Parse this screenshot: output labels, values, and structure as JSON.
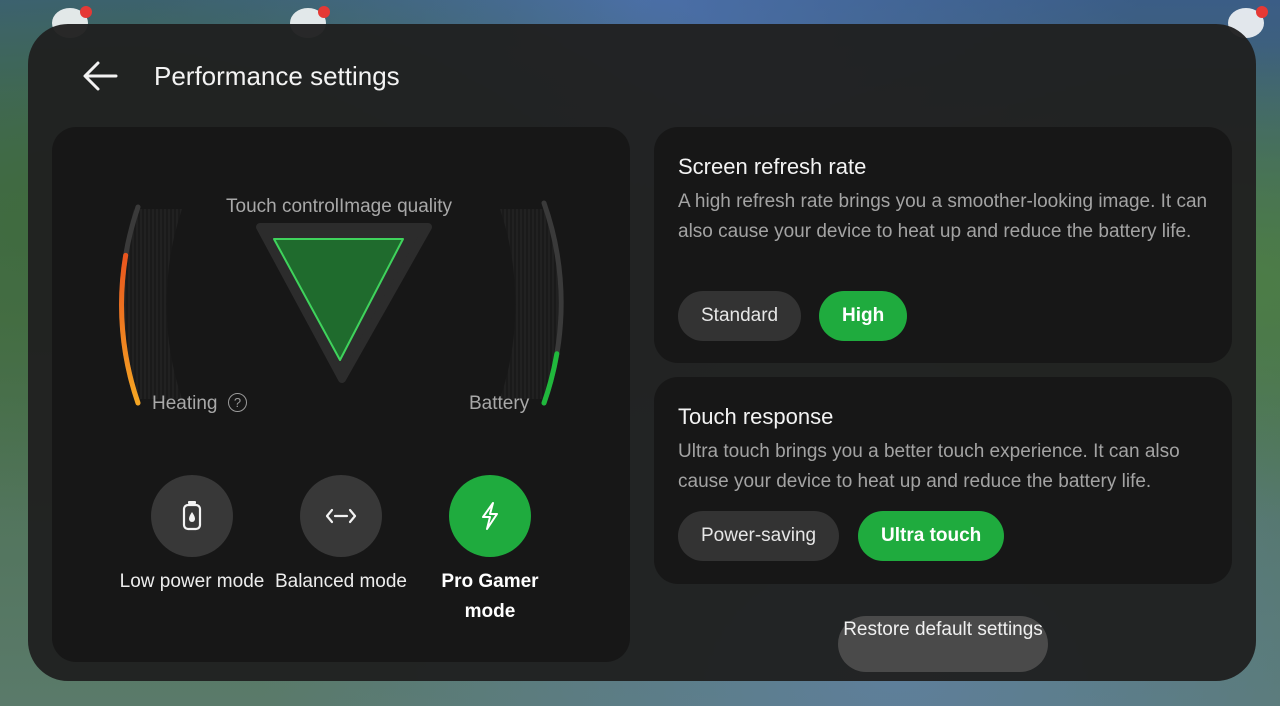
{
  "header": {
    "title": "Performance settings"
  },
  "gauges": {
    "top_label": "Touch controlImage quality",
    "left_label": "Heating",
    "right_label": "Battery",
    "help_glyph": "?",
    "heating_level": 0.75,
    "battery_level": 0.25,
    "heating_colors": [
      "#e53a1c",
      "#f5a623"
    ],
    "battery_color": "#20b83c"
  },
  "modes": [
    {
      "label": "Low power mode",
      "icon": "battery-icon",
      "active": false
    },
    {
      "label": "Balanced mode",
      "icon": "balance-arrows-icon",
      "active": false
    },
    {
      "label": "Pro Gamer mode",
      "icon": "lightning-icon",
      "active": true
    }
  ],
  "refresh_rate": {
    "title": "Screen refresh rate",
    "description": "A high refresh rate brings you a smoother-looking image. It can also cause your device to heat up and reduce the battery life.",
    "options": [
      "Standard",
      "High"
    ],
    "selected": "High"
  },
  "touch_response": {
    "title": "Touch response",
    "description": "Ultra touch brings you a better touch experience. It can also cause your device to heat up and reduce the battery life.",
    "options": [
      "Power-saving",
      "Ultra touch"
    ],
    "selected": "Ultra touch"
  },
  "restore_button": "Restore default settings",
  "colors": {
    "accent": "#1fab3e",
    "panel": "#202020",
    "card": "#171717"
  }
}
